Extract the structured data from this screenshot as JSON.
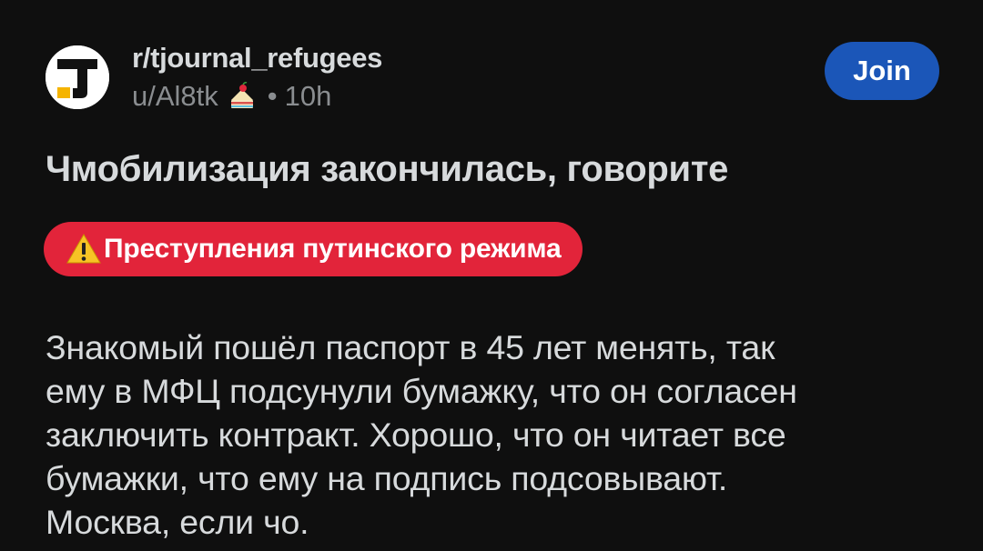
{
  "post": {
    "subreddit": "r/tjournal_refugees",
    "author": "u/Al8tk",
    "separator": "•",
    "time": "10h",
    "join_label": "Join",
    "title": "Чмобилизация закончилась, говорите",
    "flair": {
      "label": "Преступления путинского режима",
      "icon": "warning-icon",
      "color": "#e2243a"
    },
    "body_lines": [
      "Знакомый пошёл паспорт в 45 лет менять, так",
      "ему в МФЦ подсунули бумажку, что он согласен",
      "заключить контракт. Хорошо, что он читает все",
      "бумажки, что ему на подпись подсовывают.",
      "Москва, если чо."
    ]
  },
  "colors": {
    "background": "#0f0f0f",
    "join_button": "#1b56b8",
    "flair": "#e2243a",
    "text": "#d7dadc",
    "meta_text": "#8a8d90",
    "logo_accent": "#f5b400"
  },
  "icons": {
    "avatar": "tjournal-logo-icon",
    "author_badge": "cake-icon"
  }
}
